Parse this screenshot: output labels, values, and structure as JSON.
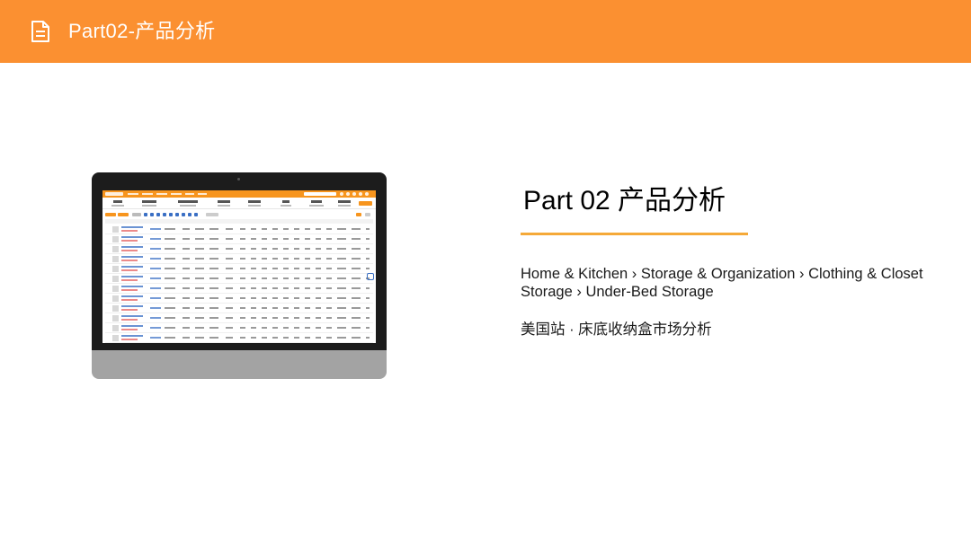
{
  "header": {
    "title": "Part02-产品分析",
    "icon": "document-icon",
    "background": "#fb9031"
  },
  "main": {
    "part_title": "Part 02  产品分析",
    "category_path": "Home & Kitchen › Storage & Organization › Clothing & Closet Storage › Under-Bed Storage",
    "market_subtitle": "美国站 · 床底收纳盒市场分析",
    "accent_color": "#f5a938"
  },
  "illustration": {
    "type": "monitor-screenshot",
    "screen_accent": "#f7951e"
  }
}
